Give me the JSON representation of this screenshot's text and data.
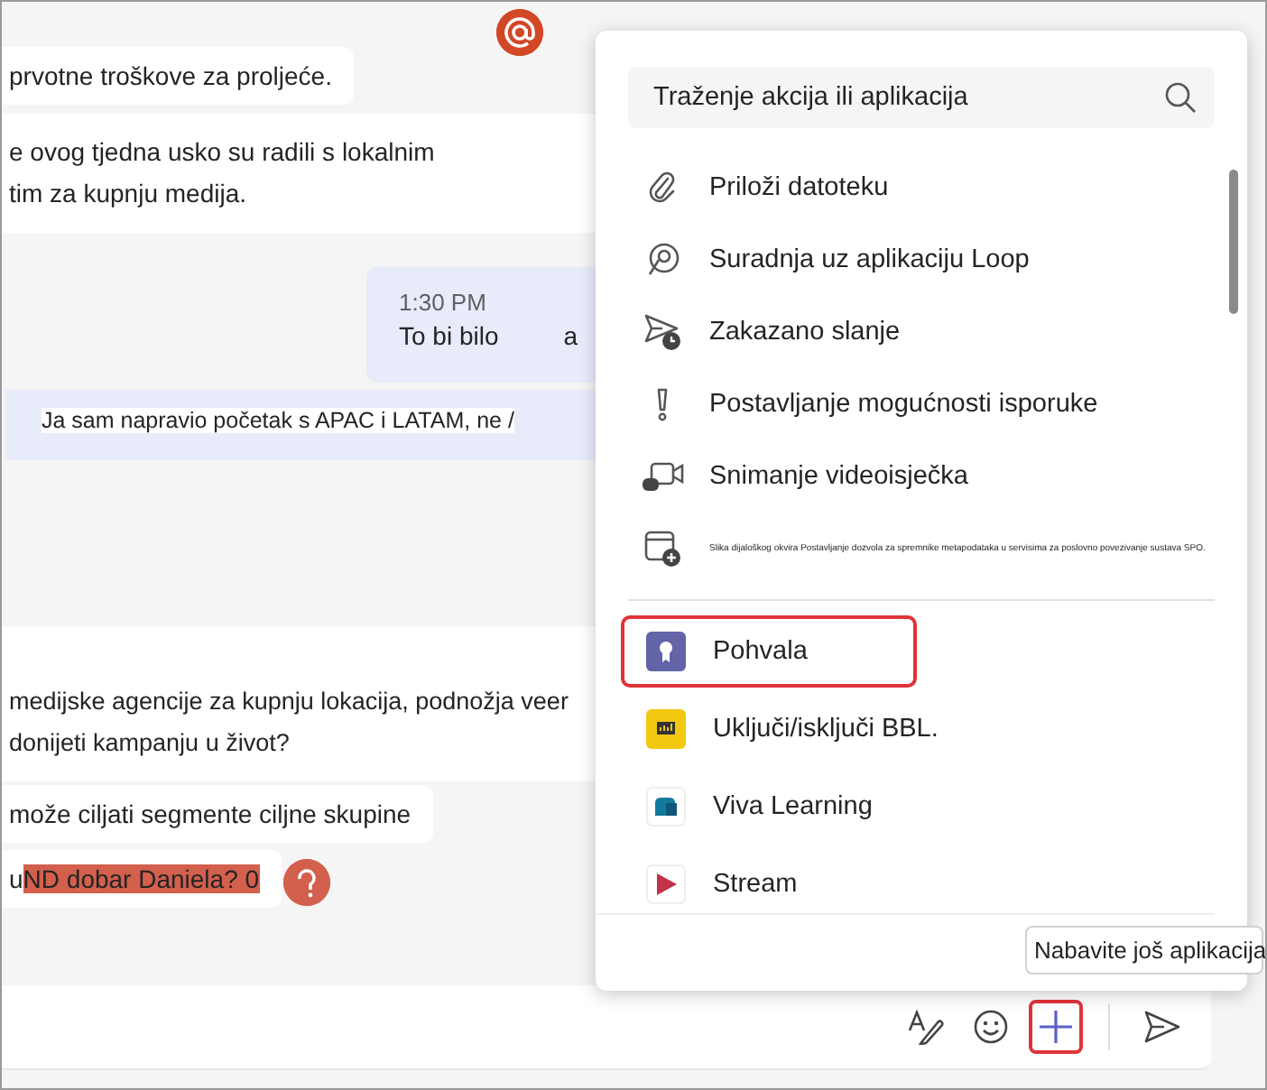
{
  "chat": {
    "messages": [
      {
        "kind": "bubble",
        "lines": [
          "prvotne troškove za proljeće."
        ],
        "mention": true
      },
      {
        "kind": "band",
        "lines": [
          "e ovog tjedna usko su radili s lokalnim",
          "tim za kupnju medija."
        ]
      },
      {
        "kind": "own",
        "time": "1:30 PM",
        "lines": [
          "To bi bilo",
          "a"
        ]
      },
      {
        "kind": "quote",
        "lines": [
          "Ja sam napravio početak s APAC i LATAM, ne /"
        ]
      },
      {
        "kind": "band",
        "lines": [
          "medijske agencije za kupnju lokacija, podnožja veer",
          "donijeti kampanju u život?"
        ]
      },
      {
        "kind": "bubble",
        "lines": [
          "može ciljati segmente ciljne skupine"
        ]
      },
      {
        "kind": "bubble",
        "lines": [
          "u"
        ],
        "highlighted_text": "ND dobar Daniela? 0",
        "reaction": true
      }
    ]
  },
  "popup": {
    "search": {
      "placeholder": "Traženje akcija ili aplikacija"
    },
    "actions": [
      {
        "label": "Priloži datoteku"
      },
      {
        "label": "Suradnja uz aplikaciju Loop"
      },
      {
        "label": "Zakazano slanje"
      },
      {
        "label": "Postavljanje mogućnosti isporuke"
      },
      {
        "label": "Snimanje videoisječka"
      },
      {
        "label": "Slika dijaloškog okvira Postavljanje dozvola za spremnike metapodataka u servisima za poslovno povezivanje sustava SPO.",
        "kind": "fine_print"
      }
    ],
    "apps": [
      {
        "label": "Pohvala",
        "selected": true
      },
      {
        "label": "Uključi/isključi BBL.",
        "selected": false
      },
      {
        "label": "Viva Learning",
        "selected": false
      },
      {
        "label": "Stream",
        "selected": false
      }
    ],
    "more_button": "Nabavite još aplikacija"
  },
  "composer": {
    "plus_selected": true
  }
}
